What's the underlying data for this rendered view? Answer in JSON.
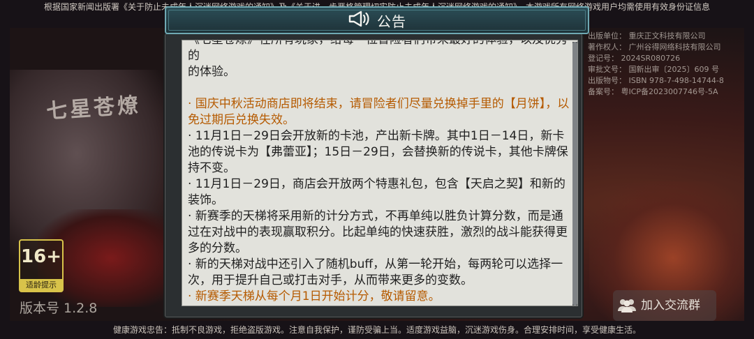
{
  "top_notice": "根据国家新闻出版署《关于防止未成年人沉迷网络游戏的通知》及《关于进一步严格管理切实防止未成年人沉迷网络游戏的通知》，本游戏所有网络游戏用户均需使用有效身份证信息",
  "bottom_notice": "健康游戏忠告：抵制不良游戏，拒绝盗版游戏。注意自我保护，谨防受骗上当。适度游戏益脑，沉迷游戏伤身。合理安排时间，享受健康生活。",
  "game_logo_text": "七星苍燎",
  "info_lines": [
    "出版单位：  重庆正文科技有限公司",
    "著作权人：  广州谷得网络科技有限公司",
    "登记号：    2024SR080726",
    "审批文号：  国新出审〔2025〕609 号",
    "出版物号：  ISBN 978-7-498-14744-8",
    "备案号：    粤ICP备2023007746号-5A"
  ],
  "age_rating": {
    "value": "16+",
    "label": "适龄提示"
  },
  "version": "版本号 1.2.8",
  "join_group_button": "加入交流群",
  "dialog": {
    "title": "公告",
    "content": [
      {
        "text": "《七星苍燎》在所有玩家，给每一位冒险者们带来最好的体验，以及优秀的",
        "highlight": false,
        "partial": true
      },
      {
        "text": "的体验。",
        "highlight": false
      },
      {
        "text": "",
        "gap": true
      },
      {
        "text": "· 国庆中秋活动商店即将结束，请冒险者们尽量兑换掉手里的【月饼】，以免过期后兑换失效。",
        "highlight": true
      },
      {
        "text": "· 11月1日－29日会开放新的卡池，产出新卡牌。其中1日－14日，新卡池的传说卡为【弗蕾亚】；15日－29日，会替换新的传说卡，其他卡牌保持不变。",
        "highlight": false
      },
      {
        "text": "· 11月1日－29日，商店会开放两个特惠礼包，包含【天启之契】和新的装饰。",
        "highlight": false
      },
      {
        "text": "· 新赛季的天梯将采用新的计分方式，不再单纯以胜负计算分数，而是通过在对战中的表现赢取积分。比起单纯的快速获胜，激烈的战斗能获得更多的分数。",
        "highlight": false
      },
      {
        "text": "· 新的天梯对战中还引入了随机buff，从第一轮开始，每两轮可以选择一次，用于提升自己或打击对手，从而带来更多的变数。",
        "highlight": false
      },
      {
        "text": "· 新赛季天梯从每个月1日开始计分，敬请留意。",
        "highlight": true
      }
    ]
  },
  "colors": {
    "highlight": "#b55a00",
    "header_border": "#6fa9b3",
    "age_badge": "#d8c34a"
  }
}
